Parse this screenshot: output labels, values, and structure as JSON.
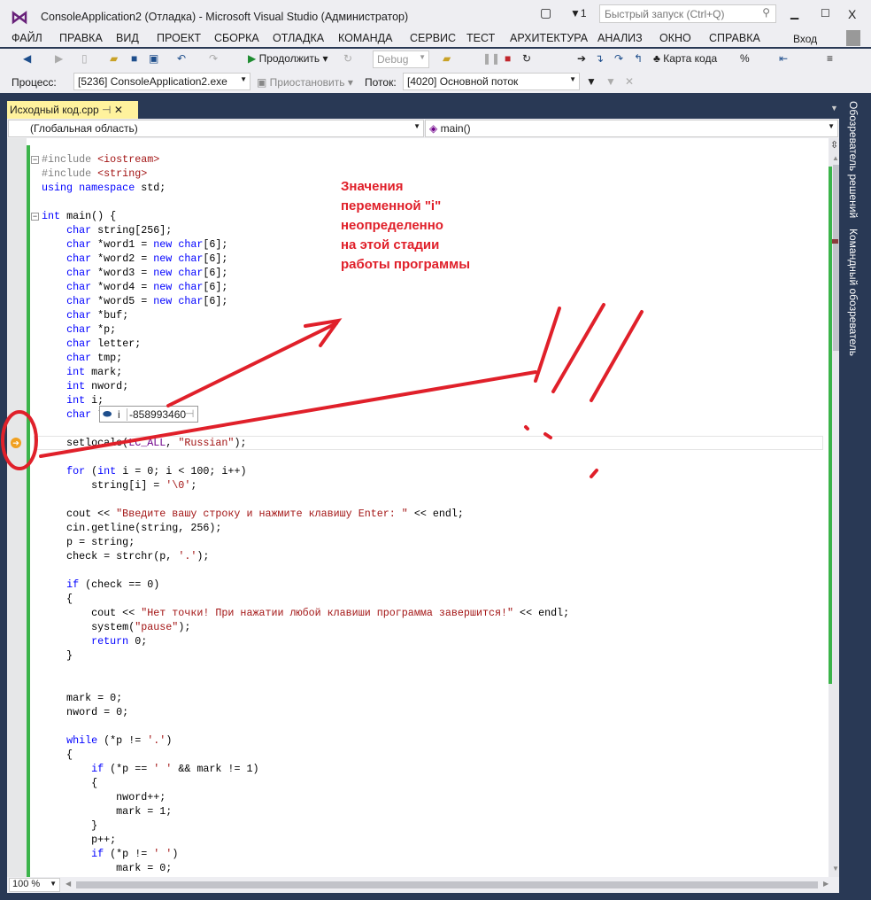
{
  "window": {
    "title": "ConsoleApplication2 (Отладка) - Microsoft Visual Studio (Администратор)",
    "notifications": "1",
    "quick_launch_placeholder": "Быстрый запуск (Ctrl+Q)",
    "signin": "Вход"
  },
  "menu": [
    "ФАЙЛ",
    "ПРАВКА",
    "ВИД",
    "ПРОЕКТ",
    "СБОРКА",
    "ОТЛАДКА",
    "КОМАНДА",
    "СЕРВИС",
    "ТЕСТ",
    "АРХИТЕКТУРА",
    "АНАЛИЗ",
    "ОКНО",
    "СПРАВКА"
  ],
  "toolbar": {
    "continue": "Продолжить",
    "config": "Debug",
    "code_map": "Карта кода"
  },
  "debug_bar": {
    "process_label": "Процесс:",
    "process": "[5236] ConsoleApplication2.exe",
    "suspend": "Приостановить",
    "thread_label": "Поток:",
    "thread": "[4020] Основной поток"
  },
  "tab": {
    "name": "Исходный код.cpp"
  },
  "nav": {
    "scope": "(Глобальная область)",
    "member": "main()"
  },
  "right_panel": [
    "Обозреватель решений",
    "Командный обозреватель"
  ],
  "tooltip": {
    "var": "i",
    "value": "-858993460"
  },
  "annotation": [
    "Значения",
    "переменной \"i\"",
    "неопределенно",
    "на этой стадии",
    "работы программы"
  ],
  "zoom": "100 %",
  "code": [
    [
      [
        "pp",
        "#include "
      ],
      [
        "str",
        "<iostream>"
      ]
    ],
    [
      [
        "pp",
        "#include "
      ],
      [
        "str",
        "<string>"
      ]
    ],
    [
      [
        "kw",
        "using namespace "
      ],
      [
        "id",
        "std;"
      ]
    ],
    [],
    [
      [
        "kw",
        "int "
      ],
      [
        "id",
        "main() {"
      ]
    ],
    [
      [
        "id",
        "    "
      ],
      [
        "kw",
        "char "
      ],
      [
        "id",
        "string[256];"
      ]
    ],
    [
      [
        "id",
        "    "
      ],
      [
        "kw",
        "char "
      ],
      [
        "id",
        "*word1 = "
      ],
      [
        "kw",
        "new char"
      ],
      [
        "id",
        "[6];"
      ]
    ],
    [
      [
        "id",
        "    "
      ],
      [
        "kw",
        "char "
      ],
      [
        "id",
        "*word2 = "
      ],
      [
        "kw",
        "new char"
      ],
      [
        "id",
        "[6];"
      ]
    ],
    [
      [
        "id",
        "    "
      ],
      [
        "kw",
        "char "
      ],
      [
        "id",
        "*word3 = "
      ],
      [
        "kw",
        "new char"
      ],
      [
        "id",
        "[6];"
      ]
    ],
    [
      [
        "id",
        "    "
      ],
      [
        "kw",
        "char "
      ],
      [
        "id",
        "*word4 = "
      ],
      [
        "kw",
        "new char"
      ],
      [
        "id",
        "[6];"
      ]
    ],
    [
      [
        "id",
        "    "
      ],
      [
        "kw",
        "char "
      ],
      [
        "id",
        "*word5 = "
      ],
      [
        "kw",
        "new char"
      ],
      [
        "id",
        "[6];"
      ]
    ],
    [
      [
        "id",
        "    "
      ],
      [
        "kw",
        "char "
      ],
      [
        "id",
        "*buf;"
      ]
    ],
    [
      [
        "id",
        "    "
      ],
      [
        "kw",
        "char "
      ],
      [
        "id",
        "*p;"
      ]
    ],
    [
      [
        "id",
        "    "
      ],
      [
        "kw",
        "char "
      ],
      [
        "id",
        "letter;"
      ]
    ],
    [
      [
        "id",
        "    "
      ],
      [
        "kw",
        "char "
      ],
      [
        "id",
        "tmp;"
      ]
    ],
    [
      [
        "id",
        "    "
      ],
      [
        "kw",
        "int "
      ],
      [
        "id",
        "mark;"
      ]
    ],
    [
      [
        "id",
        "    "
      ],
      [
        "kw",
        "int "
      ],
      [
        "id",
        "nword;"
      ]
    ],
    [
      [
        "id",
        "    "
      ],
      [
        "kw",
        "int "
      ],
      [
        "id",
        "i;"
      ]
    ],
    [
      [
        "id",
        "    "
      ],
      [
        "kw",
        "char "
      ],
      [
        "id",
        "*check;"
      ]
    ],
    [],
    [
      [
        "id",
        "    setlocale("
      ],
      [
        "mac",
        "LC_ALL"
      ],
      [
        "id",
        ", "
      ],
      [
        "str",
        "\"Russian\""
      ],
      [
        "id",
        ");"
      ]
    ],
    [],
    [
      [
        "id",
        "    "
      ],
      [
        "kw",
        "for "
      ],
      [
        "id",
        "("
      ],
      [
        "kw",
        "int "
      ],
      [
        "id",
        "i = 0; i < 100; i++)"
      ]
    ],
    [
      [
        "id",
        "        string[i] = "
      ],
      [
        "ch",
        "'\\0'"
      ],
      [
        "id",
        ";"
      ]
    ],
    [],
    [
      [
        "id",
        "    cout << "
      ],
      [
        "str",
        "\"Введите вашу строку и нажмите клавишу Enter: \""
      ],
      [
        "id",
        " << endl;"
      ]
    ],
    [
      [
        "id",
        "    cin.getline(string, 256);"
      ]
    ],
    [
      [
        "id",
        "    p = string;"
      ]
    ],
    [
      [
        "id",
        "    check = strchr(p, "
      ],
      [
        "ch",
        "'.'"
      ],
      [
        "id",
        ");"
      ]
    ],
    [],
    [
      [
        "id",
        "    "
      ],
      [
        "kw",
        "if "
      ],
      [
        "id",
        "(check == 0)"
      ]
    ],
    [
      [
        "id",
        "    {"
      ]
    ],
    [
      [
        "id",
        "        cout << "
      ],
      [
        "str",
        "\"Нет точки! При нажатии любой клавиши программа завершится!\""
      ],
      [
        "id",
        " << endl;"
      ]
    ],
    [
      [
        "id",
        "        system("
      ],
      [
        "str",
        "\"pause\""
      ],
      [
        "id",
        ");"
      ]
    ],
    [
      [
        "id",
        "        "
      ],
      [
        "kw",
        "return "
      ],
      [
        "id",
        "0;"
      ]
    ],
    [
      [
        "id",
        "    }"
      ]
    ],
    [],
    [],
    [
      [
        "id",
        "    mark = 0;"
      ]
    ],
    [
      [
        "id",
        "    nword = 0;"
      ]
    ],
    [],
    [
      [
        "id",
        "    "
      ],
      [
        "kw",
        "while "
      ],
      [
        "id",
        "(*p != "
      ],
      [
        "ch",
        "'.'"
      ],
      [
        "id",
        ")"
      ]
    ],
    [
      [
        "id",
        "    {"
      ]
    ],
    [
      [
        "id",
        "        "
      ],
      [
        "kw",
        "if "
      ],
      [
        "id",
        "(*p == "
      ],
      [
        "ch",
        "' '"
      ],
      [
        "id",
        " && mark != 1)"
      ]
    ],
    [
      [
        "id",
        "        {"
      ]
    ],
    [
      [
        "id",
        "            nword++;"
      ]
    ],
    [
      [
        "id",
        "            mark = 1;"
      ]
    ],
    [
      [
        "id",
        "        }"
      ]
    ],
    [
      [
        "id",
        "        p++;"
      ]
    ],
    [
      [
        "id",
        "        "
      ],
      [
        "kw",
        "if "
      ],
      [
        "id",
        "(*p != "
      ],
      [
        "ch",
        "' '"
      ],
      [
        "id",
        ")"
      ]
    ],
    [
      [
        "id",
        "            mark = 0;"
      ]
    ]
  ]
}
